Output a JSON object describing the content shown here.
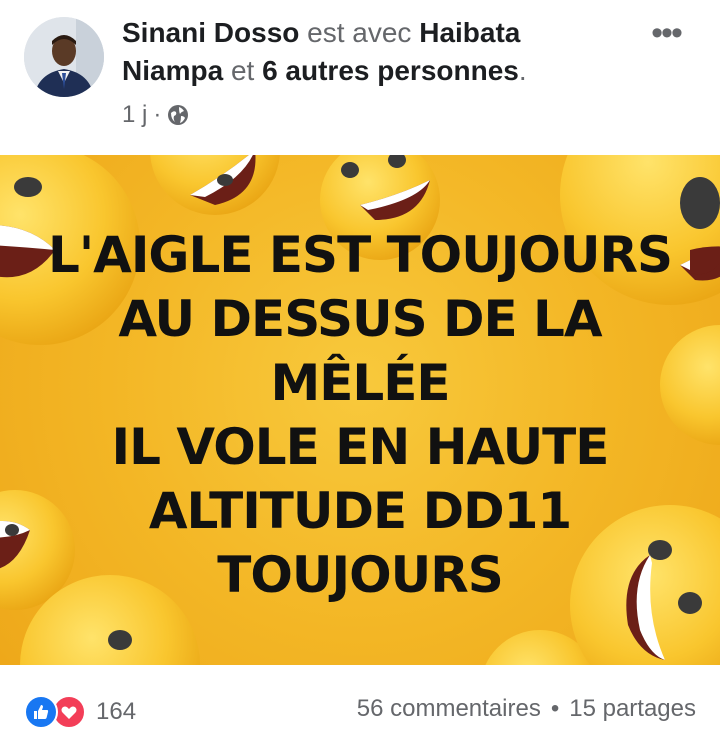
{
  "post": {
    "author": "Sinani Dosso",
    "with_text": "est avec",
    "tagged_person": "Haibata Niampa",
    "and_text": "et",
    "others": "6 autres personnes",
    "period": ".",
    "time": "1 j",
    "separator": "·",
    "privacy_icon": "globe-icon",
    "more_icon": "more-options-icon",
    "more_label": "•••"
  },
  "image": {
    "lines": [
      "L'AIGLE EST TOUJOURS",
      "AU DESSUS DE LA",
      "MÊLÉE",
      "IL VOLE EN HAUTE",
      "ALTITUDE DD11",
      "TOUJOURS"
    ],
    "background_color": "#f3b625"
  },
  "footer": {
    "reaction_count": "164",
    "comments": "56 commentaires",
    "dot": "•",
    "shares": "15 partages",
    "reaction_icons": [
      "like-icon",
      "love-icon"
    ]
  },
  "colors": {
    "like": "#1877f2",
    "love": "#f33e58",
    "muted_text": "#65676b"
  }
}
